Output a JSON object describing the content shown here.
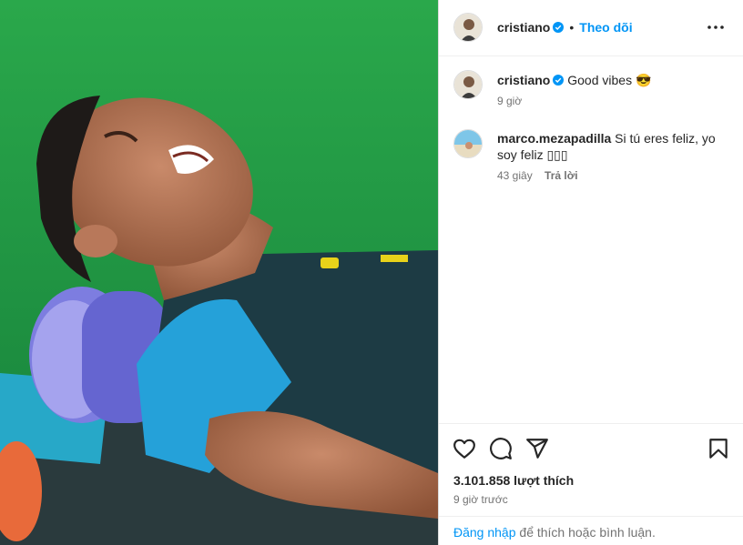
{
  "post": {
    "username": "cristiano",
    "follow_label": "Theo dõi",
    "more_icon": "more-horizontal-icon",
    "caption": {
      "username": "cristiano",
      "text": "Good vibes 😎",
      "time": "9 giờ"
    },
    "comments": [
      {
        "username": "marco.mezapadilla",
        "text": "Si tú eres feliz, yo soy feliz ▯▯▯",
        "time": "43 giây",
        "reply_label": "Trả lời"
      }
    ],
    "likes": "3.101.858 lượt thích",
    "posted_ago": "9 giờ trước",
    "login_link": "Đăng nhập",
    "login_rest": " để thích hoặc bình luận."
  },
  "colors": {
    "accent": "#0095f6",
    "verified": "#0095f6",
    "text": "#262626",
    "muted": "#737373"
  }
}
